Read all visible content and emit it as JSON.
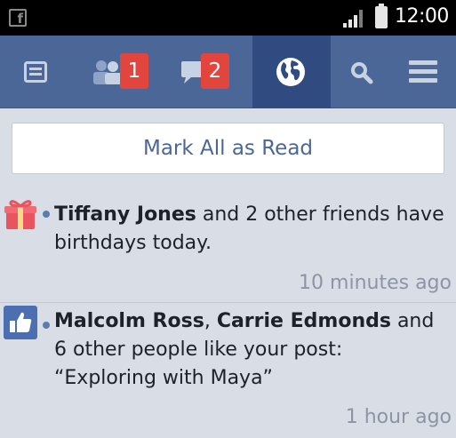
{
  "status_bar": {
    "time": "12:00",
    "app_icon_glyph": "f",
    "icons": [
      "facebook-notification-icon",
      "signal-icon",
      "battery-icon"
    ]
  },
  "nav": {
    "tabs": [
      {
        "name": "news-feed",
        "icon": "news-feed-icon",
        "badge": null
      },
      {
        "name": "friend-requests",
        "icon": "friends-icon",
        "badge": "1"
      },
      {
        "name": "messages",
        "icon": "messages-icon",
        "badge": "2"
      },
      {
        "name": "notifications",
        "icon": "globe-icon",
        "badge": null,
        "active": true
      },
      {
        "name": "search",
        "icon": "search-icon",
        "badge": null
      },
      {
        "name": "menu",
        "icon": "menu-icon",
        "badge": null
      }
    ],
    "colors": {
      "bar": "#4b6797",
      "active": "#2f4b7f",
      "badge": "#e1453d"
    }
  },
  "mark_all_label": "Mark All as Read",
  "notifications": [
    {
      "icon": "gift-icon",
      "actors": "Tiffany Jones",
      "message": " and 2 other friends have birthdays today.",
      "time": "10 minutes ago"
    },
    {
      "icon": "thumbs-up-icon",
      "actor_1": "Malcolm Ross",
      "separator": ", ",
      "actor_2": "Carrie Edmonds",
      "message": " and 6 other people like your post: “Exploring with Maya”",
      "time": "1 hour ago"
    }
  ]
}
